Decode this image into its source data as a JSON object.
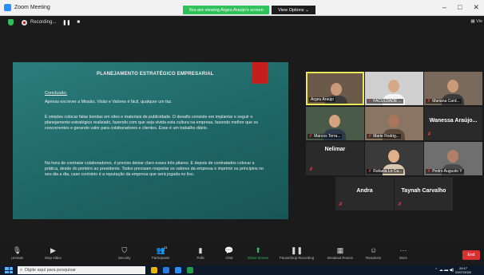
{
  "window": {
    "title": "Zoom Meeting",
    "share_banner": "You are viewing Argeu Araújo's screen",
    "view_options": "View Options ⌄",
    "controls": {
      "minimize": "–",
      "maximize": "□",
      "close": "✕"
    }
  },
  "topstrip": {
    "recording_label": "Recording...",
    "pause_label": "❚❚",
    "stop_label": "■",
    "view_label": "▦ Vie"
  },
  "slide": {
    "title": "PLANEJAMENTO ESTRATÉGICO EMPRESARIAL",
    "subtitle": "Conclusão:",
    "paragraphs": [
      "Apenas escrever a Missão, Visão e Valores é fácil, qualquer um faz.",
      "É simples colocar falas bonitas em sites e materiais de publicidade. O desafio consiste em implantar e  seguir o planejamento estratégico realizado, fazendo com que seja vivida esta cultura na empresa, fazendo melhor que os concorrentes e gerando valor para colaboradores e clientes. Esse é um trabalho diário.",
      "Na hora de contratar colaboradores, é preciso deixar claro esses três pilares. E depois de contratados colocar a prática, desde do porteiro ao presidente. Todos precisam respeitar os valores da empresa e imprimir os princípios no seu dia a dia, caso contrário é a reputação da empresa que será jogada no lixo."
    ],
    "accent_color": "#c61d1d"
  },
  "participants": [
    {
      "name": "Argeu Araújo",
      "muted": false,
      "video": true,
      "active": true
    },
    {
      "name": "FACULDADE ...",
      "muted": true,
      "video": true
    },
    {
      "name": "Mariana Card...",
      "muted": true,
      "video": true
    },
    {
      "name": "Marcos Terra...",
      "muted": true,
      "video": true
    },
    {
      "name": "Marie Rodrig...",
      "muted": true,
      "video": true
    },
    {
      "name": "Wanessa Araújo...",
      "muted": true,
      "video": false
    },
    {
      "name": "Nelimar",
      "muted": true,
      "video": false
    },
    {
      "name": "Rafaela Lo Ca...",
      "muted": true,
      "video": true
    },
    {
      "name": "Pedro Augusto Y",
      "muted": true,
      "video": true
    },
    {
      "name": "Andra",
      "muted": true,
      "video": false
    },
    {
      "name": "Taynah Carvalho",
      "muted": true,
      "video": false
    }
  ],
  "mute_glyph": "✗",
  "toolbar": {
    "items": [
      {
        "label": "Unmute",
        "icon": "microphone-icon",
        "glyph": "🎙"
      },
      {
        "label": "Stop Video",
        "icon": "video-camera-icon",
        "glyph": "▶"
      },
      {
        "label": "Security",
        "icon": "shield-icon",
        "glyph": "⛉"
      },
      {
        "label": "Participants",
        "icon": "participants-icon",
        "glyph": "👥",
        "count": "11"
      },
      {
        "label": "Polls",
        "icon": "polls-icon",
        "glyph": "▮"
      },
      {
        "label": "Chat",
        "icon": "chat-icon",
        "glyph": "💬"
      },
      {
        "label": "Share Screen",
        "icon": "share-screen-icon",
        "glyph": "⬆"
      },
      {
        "label": "Pause/Stop Recording",
        "icon": "recording-icon",
        "glyph": "❚❚"
      },
      {
        "label": "Breakout Rooms",
        "icon": "breakout-rooms-icon",
        "glyph": "▦"
      },
      {
        "label": "Reactions",
        "icon": "reactions-icon",
        "glyph": "☺"
      },
      {
        "label": "More",
        "icon": "more-icon",
        "glyph": "···"
      }
    ],
    "end_label": "End",
    "share_color": "#2fc25b"
  },
  "taskbar": {
    "search_placeholder": "Digite aqui para pesquisar",
    "time": "20:17",
    "date": "22/07/2020"
  }
}
